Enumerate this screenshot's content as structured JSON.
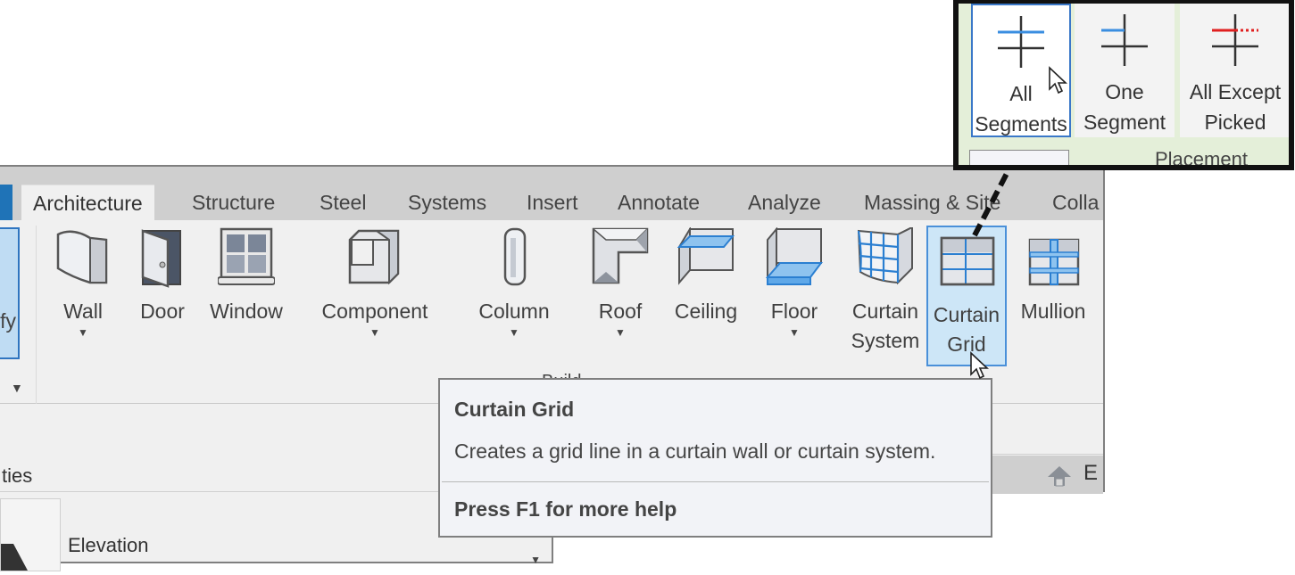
{
  "ribbon": {
    "tabs": [
      {
        "label": "Architecture",
        "active": true
      },
      {
        "label": "Structure"
      },
      {
        "label": "Steel"
      },
      {
        "label": "Systems"
      },
      {
        "label": "Insert"
      },
      {
        "label": "Annotate"
      },
      {
        "label": "Analyze"
      },
      {
        "label": "Massing & Site"
      },
      {
        "label": "Colla"
      }
    ],
    "modify_label": "fy",
    "panel_label": "Build",
    "tools": [
      {
        "label": "Wall",
        "icon": "wall-icon",
        "dropdown": true
      },
      {
        "label": "Door",
        "icon": "door-icon",
        "dropdown": false
      },
      {
        "label": "Window",
        "icon": "window-icon",
        "dropdown": false
      },
      {
        "label": "Component",
        "icon": "component-icon",
        "dropdown": true
      },
      {
        "label": "Column",
        "icon": "column-icon",
        "dropdown": true
      },
      {
        "label": "Roof",
        "icon": "roof-icon",
        "dropdown": true
      },
      {
        "label": "Ceiling",
        "icon": "ceiling-icon",
        "dropdown": false
      },
      {
        "label": "Floor",
        "icon": "floor-icon",
        "dropdown": true
      },
      {
        "label_line1": "Curtain",
        "label_line2": "System",
        "icon": "curtain-system-icon"
      },
      {
        "label_line1": "Curtain",
        "label_line2": "Grid",
        "icon": "curtain-grid-icon",
        "selected": true
      },
      {
        "label": "Mullion",
        "icon": "mullion-icon"
      }
    ]
  },
  "properties": {
    "title": "ties",
    "type_label": "Elevation",
    "collapsed_label": "E"
  },
  "tooltip": {
    "title": "Curtain Grid",
    "description": "Creates a grid line in a curtain wall or curtain system.",
    "help": "Press F1 for more help"
  },
  "callout": {
    "panel_label": "Placement",
    "buttons": [
      {
        "line1": "All",
        "line2": "Segments",
        "icon": "all-segments-icon",
        "active": true
      },
      {
        "line1": "One",
        "line2": "Segment",
        "icon": "one-segment-icon"
      },
      {
        "line1": "All Except",
        "line2": "Picked",
        "icon": "all-except-picked-icon"
      }
    ]
  },
  "colors": {
    "accent_blue": "#3a78c8",
    "selected_fill": "#cde6f7",
    "callout_border": "#111111",
    "red_segment": "#e02020"
  }
}
